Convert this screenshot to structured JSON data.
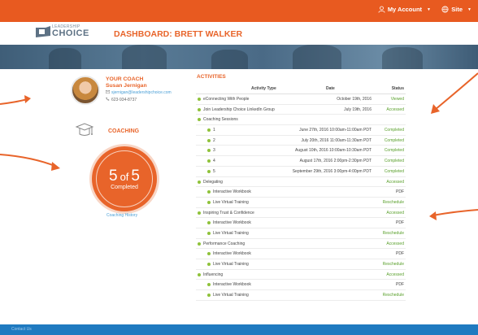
{
  "topbar": {
    "account_label": "My Account",
    "site_label": "Site"
  },
  "logo": {
    "line1": "LEADERSHIP",
    "line2": "CHOICE"
  },
  "dashboard": {
    "title": "DASHBOARD: BRETT WALKER"
  },
  "coach": {
    "label": "YOUR COACH",
    "name": "Susan Jernigan",
    "email": "sjernigan@leadershipchoice.com",
    "phone": "623-934-8737"
  },
  "coaching": {
    "label": "COACHING",
    "completed": "5",
    "of": "of",
    "total": "5",
    "status": "Completed",
    "history_link": "Coaching History",
    "progress_fraction": 1.0
  },
  "activities": {
    "title": "ACTIVITIES",
    "headers": [
      "Activity Type",
      "Date",
      "Status"
    ],
    "rows": [
      {
        "name": "eConnecting With People",
        "date": "October 19th, 2016",
        "status": "Viewed",
        "level": 0
      },
      {
        "name": "Join Leadership Choice LinkedIn Group",
        "date": "July 19th, 2016",
        "status": "Accessed",
        "level": 0
      },
      {
        "name": "Coaching Sessions",
        "date": "",
        "status": "",
        "level": 0
      },
      {
        "name": "1",
        "date": "June 27th, 2016 10:00am-11:00am PDT",
        "status": "Completed",
        "level": 1
      },
      {
        "name": "2",
        "date": "July 20th, 2016 11:00am-11:30am PDT",
        "status": "Completed",
        "level": 1
      },
      {
        "name": "3",
        "date": "August 10th, 2016 10:00am-10:30am PDT",
        "status": "Completed",
        "level": 1
      },
      {
        "name": "4",
        "date": "August 17th, 2016 2:00pm-2:30pm PDT",
        "status": "Completed",
        "level": 1
      },
      {
        "name": "5",
        "date": "September 29th, 2016 3:00pm-4:00pm PDT",
        "status": "Completed",
        "level": 1
      },
      {
        "name": "Delegating",
        "date": "",
        "status": "Accessed",
        "level": 0
      },
      {
        "name": "Interactive Workbook",
        "date": "",
        "status": "PDF",
        "level": 1
      },
      {
        "name": "Live Virtual Training",
        "date": "",
        "status": "Reschedule",
        "level": 1
      },
      {
        "name": "Inspiring Trust & Confidence",
        "date": "",
        "status": "Accessed",
        "level": 0
      },
      {
        "name": "Interactive Workbook",
        "date": "",
        "status": "PDF",
        "level": 1
      },
      {
        "name": "Live Virtual Training",
        "date": "",
        "status": "Reschedule",
        "level": 1
      },
      {
        "name": "Performance Coaching",
        "date": "",
        "status": "Accessed",
        "level": 0
      },
      {
        "name": "Interactive Workbook",
        "date": "",
        "status": "PDF",
        "level": 1
      },
      {
        "name": "Live Virtual Training",
        "date": "",
        "status": "Reschedule",
        "level": 1
      },
      {
        "name": "Influencing",
        "date": "",
        "status": "Accessed",
        "level": 0
      },
      {
        "name": "Interactive Workbook",
        "date": "",
        "status": "PDF",
        "level": 1
      },
      {
        "name": "Live Virtual Training",
        "date": "",
        "status": "Reschedule",
        "level": 1
      }
    ]
  },
  "footer": {
    "link": "Contact Us"
  },
  "colors": {
    "brand_orange": "#e85a20",
    "link_blue": "#4a9fd6",
    "status_green": "#5aa02c",
    "footer_blue": "#1f7ac0"
  }
}
